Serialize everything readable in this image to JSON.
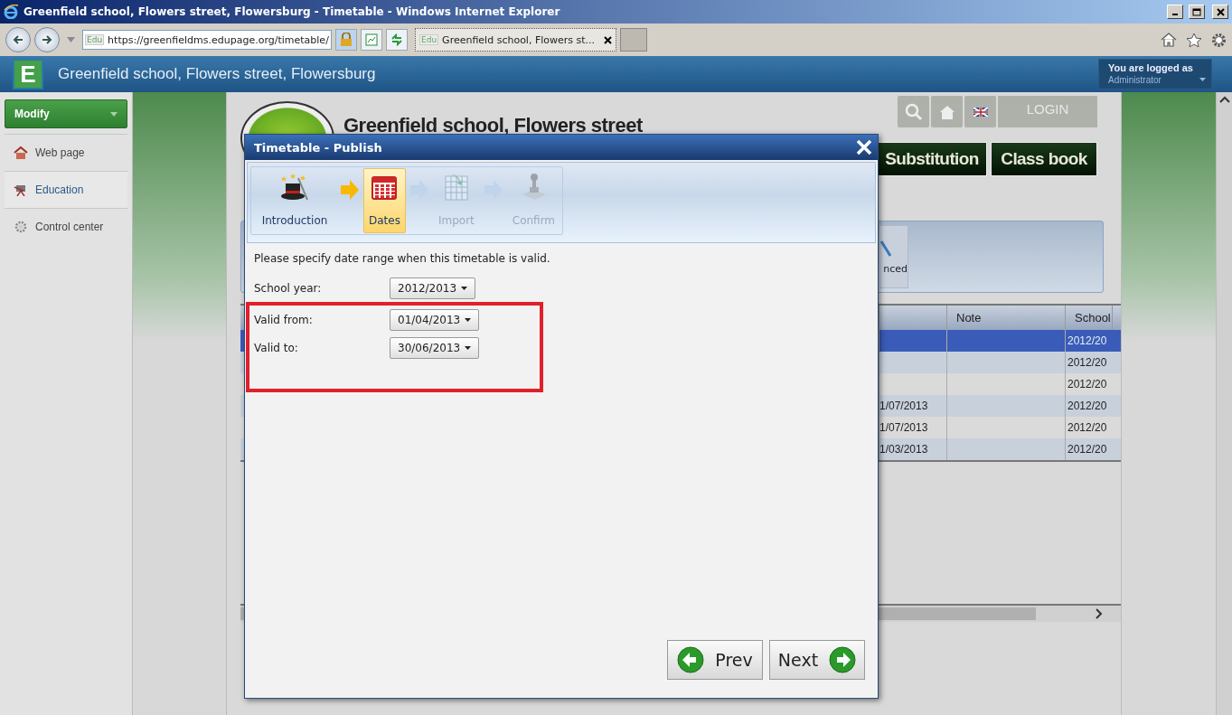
{
  "browser": {
    "title": "Greenfield school, Flowers street, Flowersburg - Timetable - Windows Internet Explorer",
    "favicon": "Edu",
    "address": "https://greenfieldms.edupage.org/timetable/",
    "tab": {
      "favicon": "Edu",
      "title": "Greenfield school, Flowers st..."
    }
  },
  "header": {
    "logo": "E",
    "title": "Greenfield school, Flowers street, Flowersburg",
    "login_label": "You are logged as",
    "user": "Administrator"
  },
  "sidebar": {
    "button": "Modify",
    "items": [
      {
        "label": "Web page",
        "kind": "house",
        "selected": false
      },
      {
        "label": "Education",
        "kind": "education",
        "selected": true
      },
      {
        "label": "Control center",
        "kind": "gear",
        "selected": false
      }
    ]
  },
  "page": {
    "title": "Greenfield school, Flowers street",
    "login": "LOGIN",
    "menu": [
      "Substitution",
      "Class book"
    ],
    "toolbar_button": "nced",
    "table": {
      "columns": [
        "Note",
        "School"
      ],
      "rows": [
        {
          "school": "2012/20",
          "selected": true
        },
        {
          "school": "2012/20",
          "selected": false
        },
        {
          "school": "2012/20",
          "selected": false
        },
        {
          "column_1": "1/07/2013",
          "school": "2012/20",
          "selected": false
        },
        {
          "column_1": "1/07/2013",
          "school": "2012/20",
          "selected": false
        },
        {
          "column_1": "1/03/2013",
          "school": "2012/20",
          "selected": false
        }
      ]
    }
  },
  "dialog": {
    "title": "Timetable - Publish",
    "steps": [
      {
        "label": "Introduction",
        "kind": "hat",
        "selected": false,
        "disabled": false
      },
      {
        "label": "Dates",
        "kind": "calendar",
        "selected": true,
        "disabled": false
      },
      {
        "label": "Import",
        "kind": "table",
        "selected": false,
        "disabled": true
      },
      {
        "label": "Confirm",
        "kind": "stamp",
        "selected": false,
        "disabled": true
      }
    ],
    "intro": "Please specify date range when this timetable is valid.",
    "fields": [
      {
        "label": "School year:",
        "value": "2012/2013",
        "highlighted": false
      },
      {
        "label": "Valid from:",
        "value": "01/04/2013",
        "highlighted": true
      },
      {
        "label": "Valid to:",
        "value": "30/06/2013",
        "highlighted": true
      }
    ],
    "buttons": [
      {
        "label": "Prev",
        "kind": "prev"
      },
      {
        "label": "Next",
        "kind": "next"
      }
    ]
  }
}
